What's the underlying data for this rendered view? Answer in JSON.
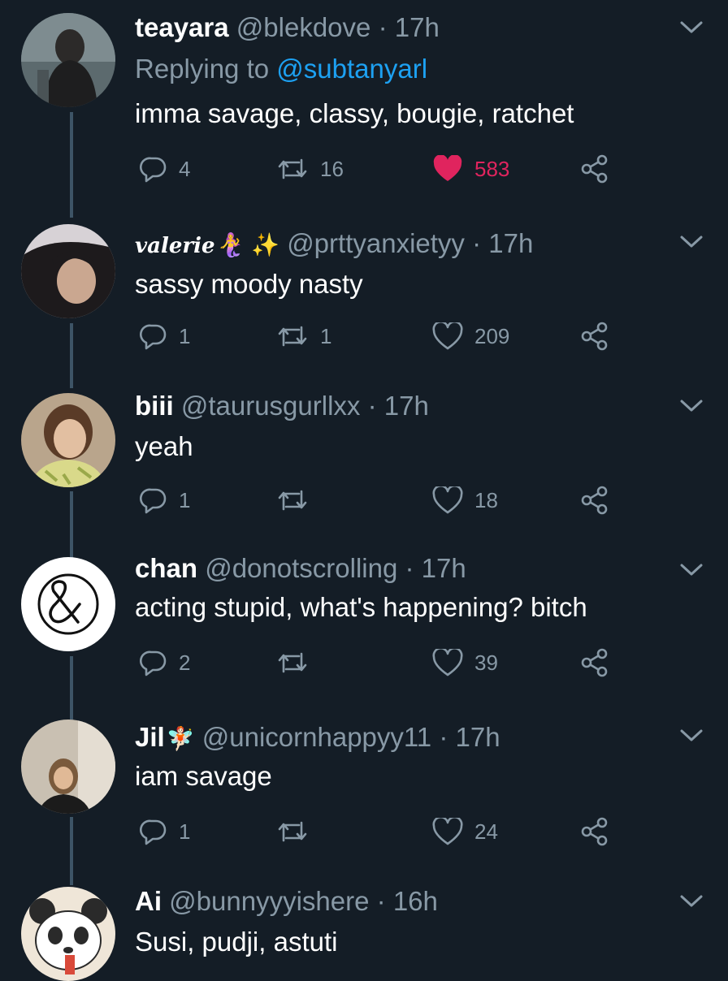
{
  "tweets": [
    {
      "name": "teayara",
      "name_emoji": "",
      "handle": "@blekdove",
      "time": "17h",
      "replying_prefix": "Replying to ",
      "replying_to": "@subtanyarl",
      "text": "imma savage, classy, bougie, ratchet",
      "replies": "4",
      "retweets": "16",
      "likes": "583",
      "liked": true
    },
    {
      "name": "valerie",
      "name_emoji": "🧜‍♀️ ✨",
      "handle": "@prttyanxietyy",
      "time": "17h",
      "text": "sassy moody nasty",
      "replies": "1",
      "retweets": "1",
      "likes": "209",
      "liked": false
    },
    {
      "name": "biii",
      "name_emoji": "",
      "handle": "@taurusgurllxx",
      "time": "17h",
      "text": "yeah",
      "replies": "1",
      "retweets": "",
      "likes": "18",
      "liked": false
    },
    {
      "name": "chan",
      "name_emoji": "",
      "handle": "@donotscrolling",
      "time": "17h",
      "text": "acting stupid, what's happening? bitch",
      "replies": "2",
      "retweets": "",
      "likes": "39",
      "liked": false
    },
    {
      "name": "Jil",
      "name_emoji": "🧚🏻",
      "handle": "@unicornhappyy11",
      "time": "17h",
      "text": "iam savage",
      "replies": "1",
      "retweets": "",
      "likes": "24",
      "liked": false
    },
    {
      "name": "Ai",
      "name_emoji": "",
      "handle": "@bunnyyyishere",
      "time": "16h",
      "text": "Susi, pudji, astuti"
    }
  ],
  "separator": "·",
  "icons": {
    "reply": "reply-icon",
    "retweet": "retweet-icon",
    "like": "heart-icon",
    "share": "share-icon",
    "menu": "chevron-down-icon"
  },
  "colors": {
    "background": "#141d26",
    "secondary_text": "#8899a6",
    "mention": "#1da1f2",
    "like_active": "#e0245e",
    "thread_line": "#3d5466"
  }
}
